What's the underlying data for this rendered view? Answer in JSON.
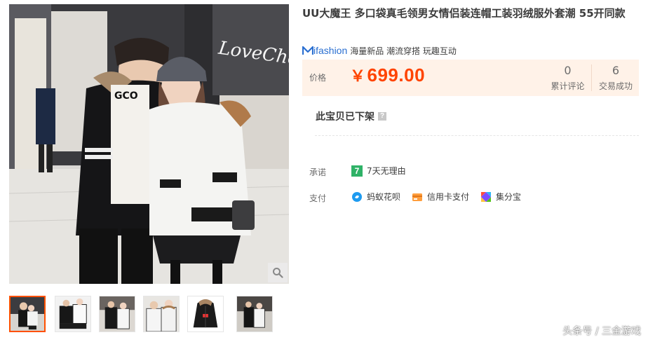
{
  "product": {
    "title": "UU大魔王 多口袋真毛领男女情侣装连帽工装羽绒服外套潮 55开同款"
  },
  "brand": {
    "logo_text": "ifashion",
    "tags": "海量新品 潮流穿搭 玩趣互动",
    "accent_color": "#2a6fd1"
  },
  "price": {
    "label": "价格",
    "currency": "￥",
    "value": "699.00",
    "color": "#ff4400"
  },
  "stats": {
    "reviews_count": "0",
    "reviews_label": "累计评论",
    "sold_count": "6",
    "sold_label": "交易成功"
  },
  "status": {
    "text": "此宝贝已下架",
    "help_icon": "?"
  },
  "service": {
    "promise_label": "承诺",
    "promise_badge": "7",
    "promise_text": "7天无理由",
    "payment_label": "支付",
    "payment_methods": [
      {
        "name": "蚂蚁花呗",
        "icon": "huabei-icon"
      },
      {
        "name": "信用卡支付",
        "icon": "credit-card-icon"
      },
      {
        "name": "集分宝",
        "icon": "jifenbao-icon"
      }
    ]
  },
  "gallery": {
    "store_sign": "LoveCheerful",
    "thumbnail_count": 6,
    "active_index": 0
  },
  "watermark": "头条号 / 三金游戏"
}
